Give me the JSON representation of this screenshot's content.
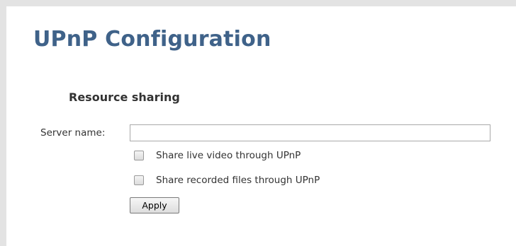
{
  "page": {
    "title": "UPnP Configuration",
    "section_title": "Resource sharing"
  },
  "form": {
    "server_name_label": "Server name:",
    "server_name_value": "",
    "options": [
      {
        "label": "Share live video through UPnP",
        "checked": false
      },
      {
        "label": "Share recorded files through UPnP",
        "checked": false
      }
    ],
    "apply_label": "Apply"
  },
  "colors": {
    "title": "#3f6289",
    "frame": "#e3e3e3"
  }
}
